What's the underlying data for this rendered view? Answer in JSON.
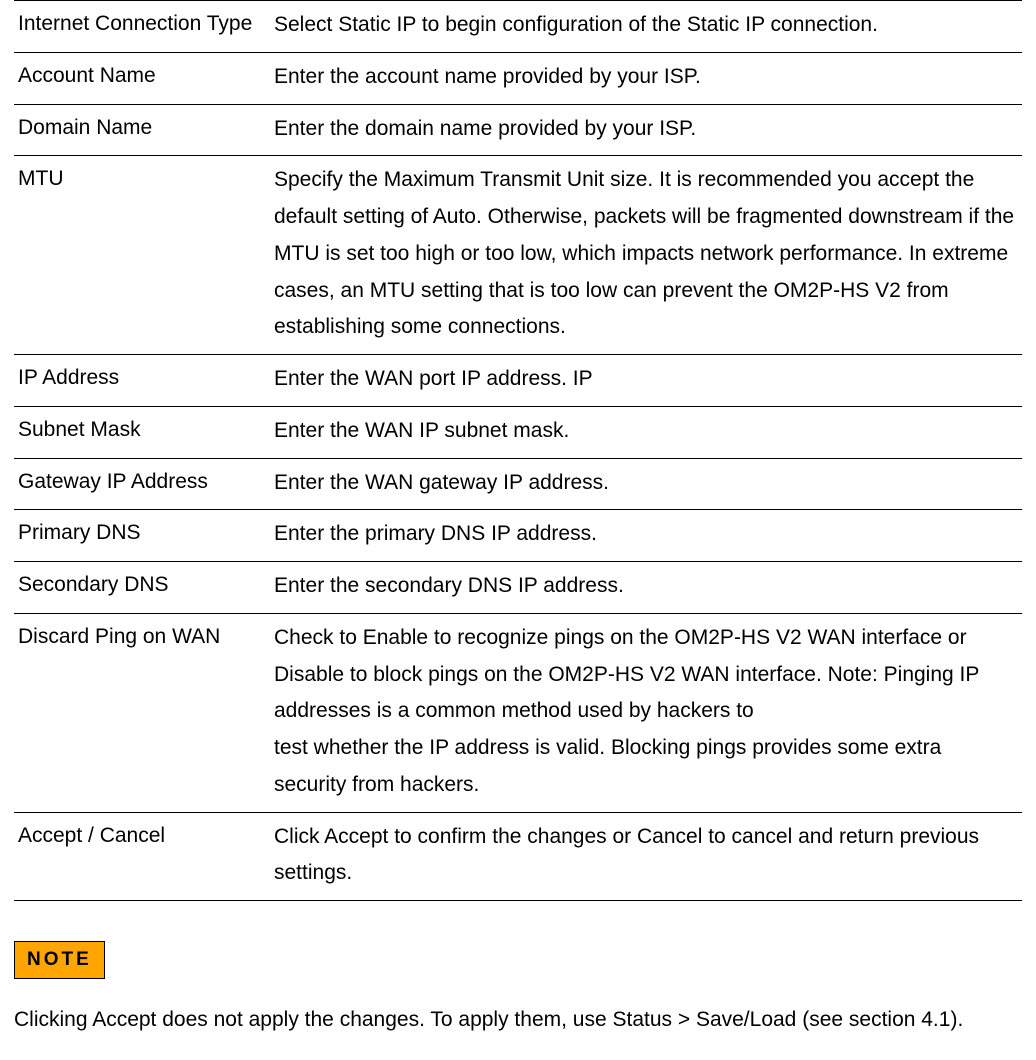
{
  "table": {
    "rows": [
      {
        "label": "Internet Connection Type",
        "desc": "Select Static IP to begin configuration of the Static IP connection."
      },
      {
        "label": "Account Name",
        "desc": "Enter the account name provided by your ISP."
      },
      {
        "label": "Domain Name",
        "desc": "Enter the domain name provided by your ISP."
      },
      {
        "label": "MTU",
        "desc": "Specify the Maximum Transmit Unit size. It is recommended you accept the default setting of Auto. Otherwise, packets will be fragmented downstream if the MTU is set too high or too low, which impacts network performance. In extreme cases, an MTU setting that is too low can prevent the OM2P-HS V2 from establishing some connections."
      },
      {
        "label": "IP Address",
        "desc": "Enter the WAN port IP address. IP"
      },
      {
        "label": "Subnet Mask",
        "desc": "Enter the WAN IP subnet mask."
      },
      {
        "label": "Gateway IP Address",
        "desc": "Enter the WAN gateway IP address."
      },
      {
        "label": "Primary DNS",
        "desc": "Enter the primary DNS IP address."
      },
      {
        "label": "Secondary DNS",
        "desc": "Enter the secondary  DNS IP address."
      },
      {
        "label": "Discard Ping on WAN",
        "desc": "Check to Enable to recognize pings on the OM2P-HS V2 WAN interface or Disable to block pings on the OM2P-HS V2 WAN interface. Note: Pinging IP addresses is a common method used by hackers to\ntest whether the IP address is valid. Blocking pings provides some extra security from hackers."
      },
      {
        "label": "Accept / Cancel",
        "desc": "Click Accept to confirm the changes or Cancel to cancel and return previous settings."
      }
    ]
  },
  "note": {
    "badge": "NOTE",
    "text": "Clicking Accept does not apply the changes. To apply them, use Status > Save/Load (see section 4.1)."
  }
}
